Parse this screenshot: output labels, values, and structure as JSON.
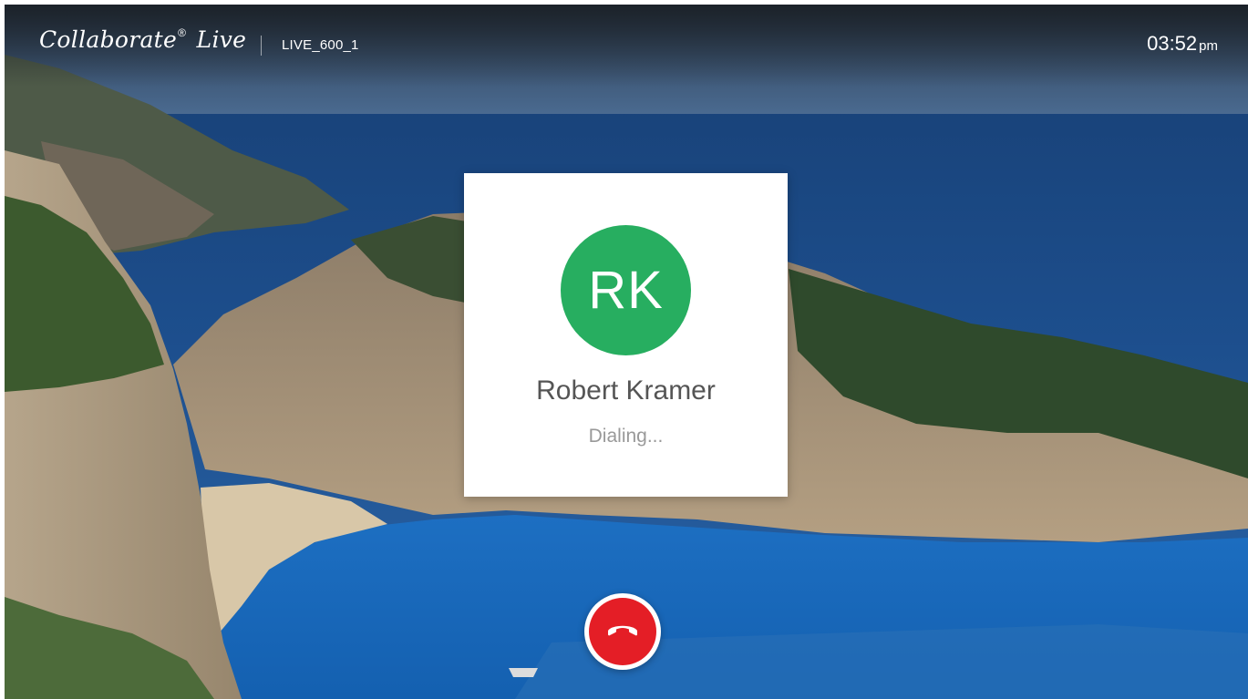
{
  "header": {
    "brand_name": "Collaborate",
    "brand_mark": "®",
    "brand_suffix": "Live",
    "room_id": "LIVE_600_1",
    "time": "03:52",
    "time_suffix": "pm"
  },
  "call": {
    "initials": "RK",
    "name": "Robert Kramer",
    "status": "Dialing...",
    "avatar_color": "#27ae60"
  },
  "controls": {
    "hangup_icon": "phone-hangup-icon",
    "hangup_color": "#e41e26"
  }
}
